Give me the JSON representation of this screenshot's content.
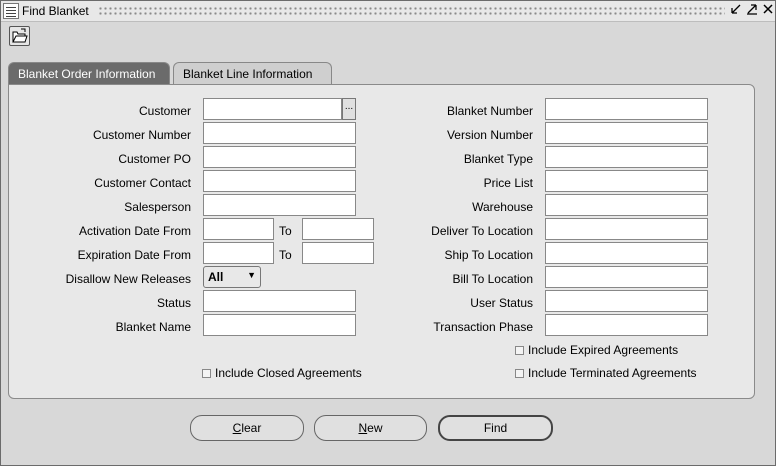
{
  "window": {
    "title": "Find Blanket"
  },
  "tabs": [
    {
      "label": "Blanket Order Information",
      "active": true
    },
    {
      "label": "Blanket Line Information",
      "active": false
    }
  ],
  "left_fields": {
    "customer": "Customer",
    "customer_number": "Customer Number",
    "customer_po": "Customer PO",
    "customer_contact": "Customer Contact",
    "salesperson": "Salesperson",
    "activation_date_from": "Activation Date From",
    "expiration_date_from": "Expiration Date From",
    "to_label": "To",
    "disallow_new_releases": "Disallow New Releases",
    "disallow_value": "All",
    "status": "Status",
    "blanket_name": "Blanket Name"
  },
  "right_fields": {
    "blanket_number": "Blanket Number",
    "version_number": "Version Number",
    "blanket_type": "Blanket Type",
    "price_list": "Price List",
    "warehouse": "Warehouse",
    "deliver_to_location": "Deliver To Location",
    "ship_to_location": "Ship To Location",
    "bill_to_location": "Bill To Location",
    "user_status": "User Status",
    "transaction_phase": "Transaction Phase"
  },
  "checkboxes": {
    "include_expired": "Include Expired Agreements",
    "include_closed": "Include Closed Agreements",
    "include_terminated": "Include Terminated Agreements"
  },
  "buttons": {
    "clear_first": "C",
    "clear_rest": "lear",
    "new_first": "N",
    "new_rest": "ew",
    "find": "Find"
  },
  "lov_label": "...",
  "poplist_arrow": "▼"
}
